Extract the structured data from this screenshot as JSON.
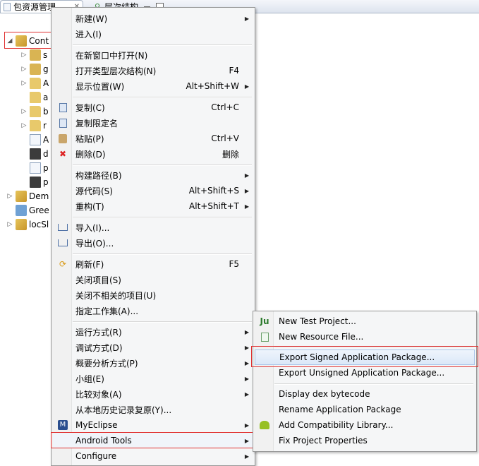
{
  "tabs": [
    {
      "label": "包资源管理",
      "close": "✕"
    },
    {
      "label": "层次结构"
    }
  ],
  "tree": [
    {
      "label": "Cont",
      "twisty": "◢",
      "icon": "project-icon"
    },
    {
      "label": "s",
      "twisty": "▷",
      "icon": "package-icon"
    },
    {
      "label": "g",
      "twisty": "▷",
      "icon": "package-icon"
    },
    {
      "label": "A",
      "twisty": "▷",
      "icon": "folder-icon"
    },
    {
      "label": "a",
      "twisty": "",
      "icon": "folder-icon"
    },
    {
      "label": "b",
      "twisty": "▷",
      "icon": "folder-icon"
    },
    {
      "label": "r",
      "twisty": "▷",
      "icon": "folder-icon"
    },
    {
      "label": "A",
      "twisty": "",
      "icon": "file-icon"
    },
    {
      "label": "d",
      "twisty": "",
      "icon": "xml-icon"
    },
    {
      "label": "p",
      "twisty": "",
      "icon": "file-icon"
    },
    {
      "label": "p",
      "twisty": "",
      "icon": "xml-icon"
    },
    {
      "label": "Dem",
      "twisty": "▷",
      "icon": "project-icon"
    },
    {
      "label": "Gree",
      "twisty": "",
      "icon": "working-set-icon"
    },
    {
      "label": "locSl",
      "twisty": "▷",
      "icon": "project-icon"
    }
  ],
  "menu": [
    {
      "label": "新建(W)",
      "shortcut": "",
      "arrow": true
    },
    {
      "label": "进入(I)",
      "shortcut": "",
      "arrow": false
    },
    {
      "label": "在新窗口中打开(N)",
      "shortcut": "",
      "arrow": false
    },
    {
      "label": "打开类型层次结构(N)",
      "shortcut": "F4",
      "arrow": false
    },
    {
      "label": "显示位置(W)",
      "shortcut": "Alt+Shift+W",
      "arrow": true
    },
    {
      "label": "复制(C)",
      "shortcut": "Ctrl+C",
      "arrow": false
    },
    {
      "label": "复制限定名",
      "shortcut": "",
      "arrow": false
    },
    {
      "label": "粘贴(P)",
      "shortcut": "Ctrl+V",
      "arrow": false
    },
    {
      "label": "删除(D)",
      "shortcut": "删除",
      "arrow": false
    },
    {
      "label": "构建路径(B)",
      "shortcut": "",
      "arrow": true
    },
    {
      "label": "源代码(S)",
      "shortcut": "Alt+Shift+S",
      "arrow": true
    },
    {
      "label": "重构(T)",
      "shortcut": "Alt+Shift+T",
      "arrow": true
    },
    {
      "label": "导入(I)...",
      "shortcut": "",
      "arrow": false
    },
    {
      "label": "导出(O)...",
      "shortcut": "",
      "arrow": false
    },
    {
      "label": "刷新(F)",
      "shortcut": "F5",
      "arrow": false
    },
    {
      "label": "关闭项目(S)",
      "shortcut": "",
      "arrow": false
    },
    {
      "label": "关闭不相关的项目(U)",
      "shortcut": "",
      "arrow": false
    },
    {
      "label": "指定工作集(A)...",
      "shortcut": "",
      "arrow": false
    },
    {
      "label": "运行方式(R)",
      "shortcut": "",
      "arrow": true
    },
    {
      "label": "调试方式(D)",
      "shortcut": "",
      "arrow": true
    },
    {
      "label": "概要分析方式(P)",
      "shortcut": "",
      "arrow": true
    },
    {
      "label": "小组(E)",
      "shortcut": "",
      "arrow": true
    },
    {
      "label": "比较对象(A)",
      "shortcut": "",
      "arrow": true
    },
    {
      "label": "从本地历史记录复原(Y)...",
      "shortcut": "",
      "arrow": false
    },
    {
      "label": "MyEclipse",
      "shortcut": "",
      "arrow": true
    },
    {
      "label": "Android Tools",
      "shortcut": "",
      "arrow": true
    },
    {
      "label": "Configure",
      "shortcut": "",
      "arrow": true
    }
  ],
  "submenu": [
    {
      "label": "New Test Project..."
    },
    {
      "label": "New Resource File..."
    },
    {
      "label": "Export Signed Application Package..."
    },
    {
      "label": "Export Unsigned Application Package..."
    },
    {
      "label": "Display dex bytecode"
    },
    {
      "label": "Rename Application Package"
    },
    {
      "label": "Add Compatibility Library..."
    },
    {
      "label": "Fix Project Properties"
    }
  ],
  "glyphs": {
    "arrow": "▶"
  }
}
